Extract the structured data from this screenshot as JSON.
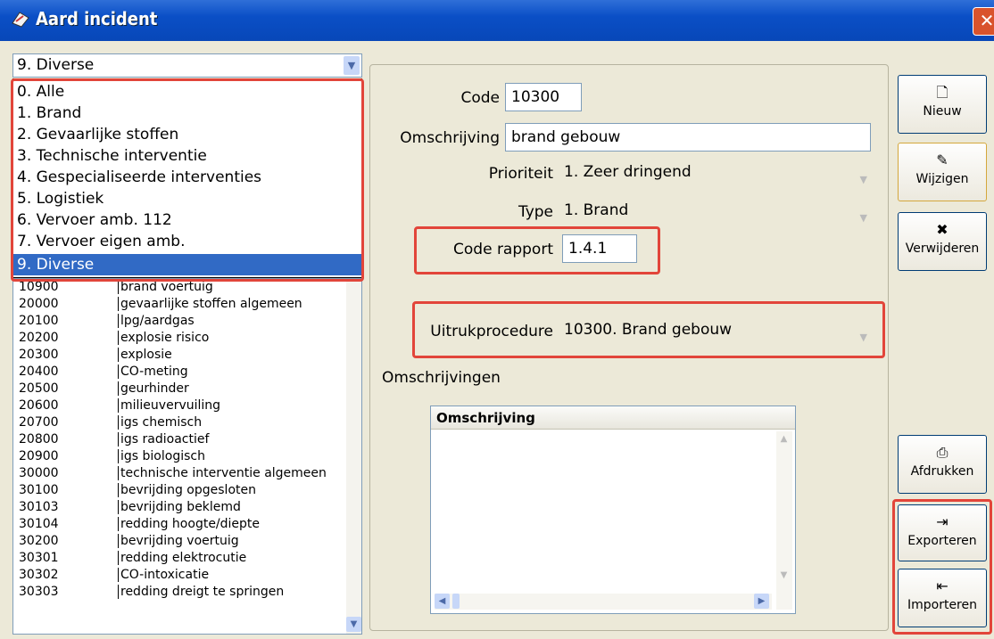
{
  "window": {
    "title": "Aard incident",
    "close": "✕"
  },
  "category_select": {
    "value": "9. Diverse"
  },
  "dropdown_options": [
    {
      "label": "0. Alle"
    },
    {
      "label": "1. Brand"
    },
    {
      "label": "2. Gevaarlijke stoffen"
    },
    {
      "label": "3. Technische interventie"
    },
    {
      "label": "4. Gespecialiseerde interventies"
    },
    {
      "label": "5. Logistiek"
    },
    {
      "label": "6. Vervoer amb. 112"
    },
    {
      "label": "7. Vervoer eigen amb."
    },
    {
      "label": "9. Diverse",
      "selected": true
    }
  ],
  "incident_rows": [
    {
      "code": "10900",
      "desc": "brand voertuig"
    },
    {
      "code": "20000",
      "desc": "gevaarlijke stoffen algemeen"
    },
    {
      "code": "20100",
      "desc": "lpg/aardgas"
    },
    {
      "code": "20200",
      "desc": "explosie risico"
    },
    {
      "code": "20300",
      "desc": "explosie"
    },
    {
      "code": "20400",
      "desc": "CO-meting"
    },
    {
      "code": "20500",
      "desc": "geurhinder"
    },
    {
      "code": "20600",
      "desc": "milieuvervuiling"
    },
    {
      "code": "20700",
      "desc": "igs chemisch"
    },
    {
      "code": "20800",
      "desc": "igs radioactief"
    },
    {
      "code": "20900",
      "desc": "igs biologisch"
    },
    {
      "code": "30000",
      "desc": "technische interventie algemeen"
    },
    {
      "code": "30100",
      "desc": "bevrijding opgesloten"
    },
    {
      "code": "30103",
      "desc": "bevrijding beklemd"
    },
    {
      "code": "30104",
      "desc": "redding hoogte/diepte"
    },
    {
      "code": "30200",
      "desc": "bevrijding voertuig"
    },
    {
      "code": "30301",
      "desc": "redding elektrocutie"
    },
    {
      "code": "30302",
      "desc": "CO-intoxicatie"
    },
    {
      "code": "30303",
      "desc": "redding dreigt te springen"
    }
  ],
  "form": {
    "code_label": "Code",
    "code_value": "10300",
    "omschrijving_label": "Omschrijving",
    "omschrijving_value": "brand gebouw",
    "prioriteit_label": "Prioriteit",
    "prioriteit_value": "1. Zeer dringend",
    "type_label": "Type",
    "type_value": "1. Brand",
    "code_rapport_label": "Code rapport",
    "code_rapport_value": "1.4.1",
    "uitruk_label": "Uitrukprocedure",
    "uitruk_value": "10300. Brand gebouw",
    "omschrijvingen_label": "Omschrijvingen",
    "grid_header": "Omschrijving"
  },
  "buttons": {
    "nieuw": "Nieuw",
    "wijzigen": "Wijzigen",
    "verwijderen": "Verwijderen",
    "afdrukken": "Afdrukken",
    "exporteren": "Exporteren",
    "importeren": "Importeren"
  },
  "colors": {
    "selection": "#316ac5",
    "highlight_border": "#e2453a",
    "titlebar": "#0a4fc6"
  }
}
